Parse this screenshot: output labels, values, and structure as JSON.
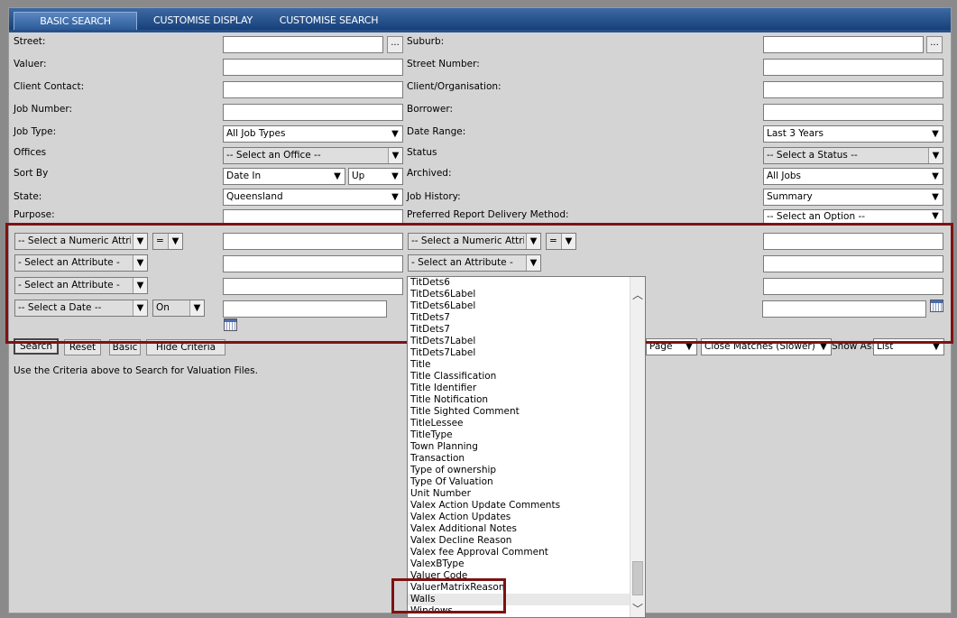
{
  "tabs": [
    {
      "label": "BASIC SEARCH",
      "active": true
    },
    {
      "label": "CUSTOMISE DISPLAY"
    },
    {
      "label": "CUSTOMISE SEARCH"
    }
  ],
  "fields": {
    "street": "Street:",
    "valuer": "Valuer:",
    "client_contact": "Client Contact:",
    "job_number": "Job Number:",
    "job_type": "Job Type:",
    "offices": "Offices",
    "sort_by": "Sort By",
    "state": "State:",
    "purpose": "Purpose:",
    "suburb": "Suburb:",
    "street_number": "Street Number:",
    "client_org": "Client/Organisation:",
    "borrower": "Borrower:",
    "date_range": "Date Range:",
    "status": "Status",
    "archived": "Archived:",
    "job_history": "Job History:",
    "preferred_delivery": "Preferred Report Delivery Method:"
  },
  "selects": {
    "job_type": "All Job Types",
    "offices": "-- Select an Office --",
    "sort_by": "Date In",
    "sort_dir": "Up",
    "state": "Queensland",
    "date_range": "Last 3 Years",
    "status": "-- Select a Status --",
    "archived": "All Jobs",
    "job_history": "Summary",
    "preferred_delivery": "-- Select an Option --"
  },
  "ellipsis": "...",
  "criteria": {
    "numeric_attr": "-- Select a Numeric Attribute --",
    "operator": "=",
    "attribute": "- Select an Attribute -",
    "date_attr": "-- Select a Date --",
    "date_op": "On"
  },
  "buttons": {
    "search": "Search",
    "reset": "Reset",
    "basic": "Basic",
    "hide_criteria": "Hide Criteria"
  },
  "right_controls": {
    "page": "Page",
    "matching": "Close Matches (Slower)",
    "show_as_label": "Show As:",
    "show_as": "List"
  },
  "info_text": "Use the Criteria above to Search for Valuation Files.",
  "dropdown_items": [
    "TitDets6",
    "TitDets6Label",
    "TitDets6Label",
    "TitDets7",
    "TitDets7",
    "TitDets7Label",
    "TitDets7Label",
    "Title",
    "Title Classification",
    "Title Identifier",
    "Title Notification",
    "Title Sighted Comment",
    "TitleLessee",
    "TitleType",
    "Town Planning",
    "Transaction",
    "Type of ownership",
    "Type Of Valuation",
    "Unit Number",
    "Valex Action Update Comments",
    "Valex Action Updates",
    "Valex Additional Notes",
    "Valex Decline Reason",
    "Valex fee Approval Comment",
    "ValexBType",
    "Valuer Code",
    "ValuerMatrixReason",
    "Walls",
    "Windows"
  ],
  "colors": {
    "tab_bar": "#17407a",
    "highlight": "#7e1212",
    "panel": "#d4d4d4"
  }
}
